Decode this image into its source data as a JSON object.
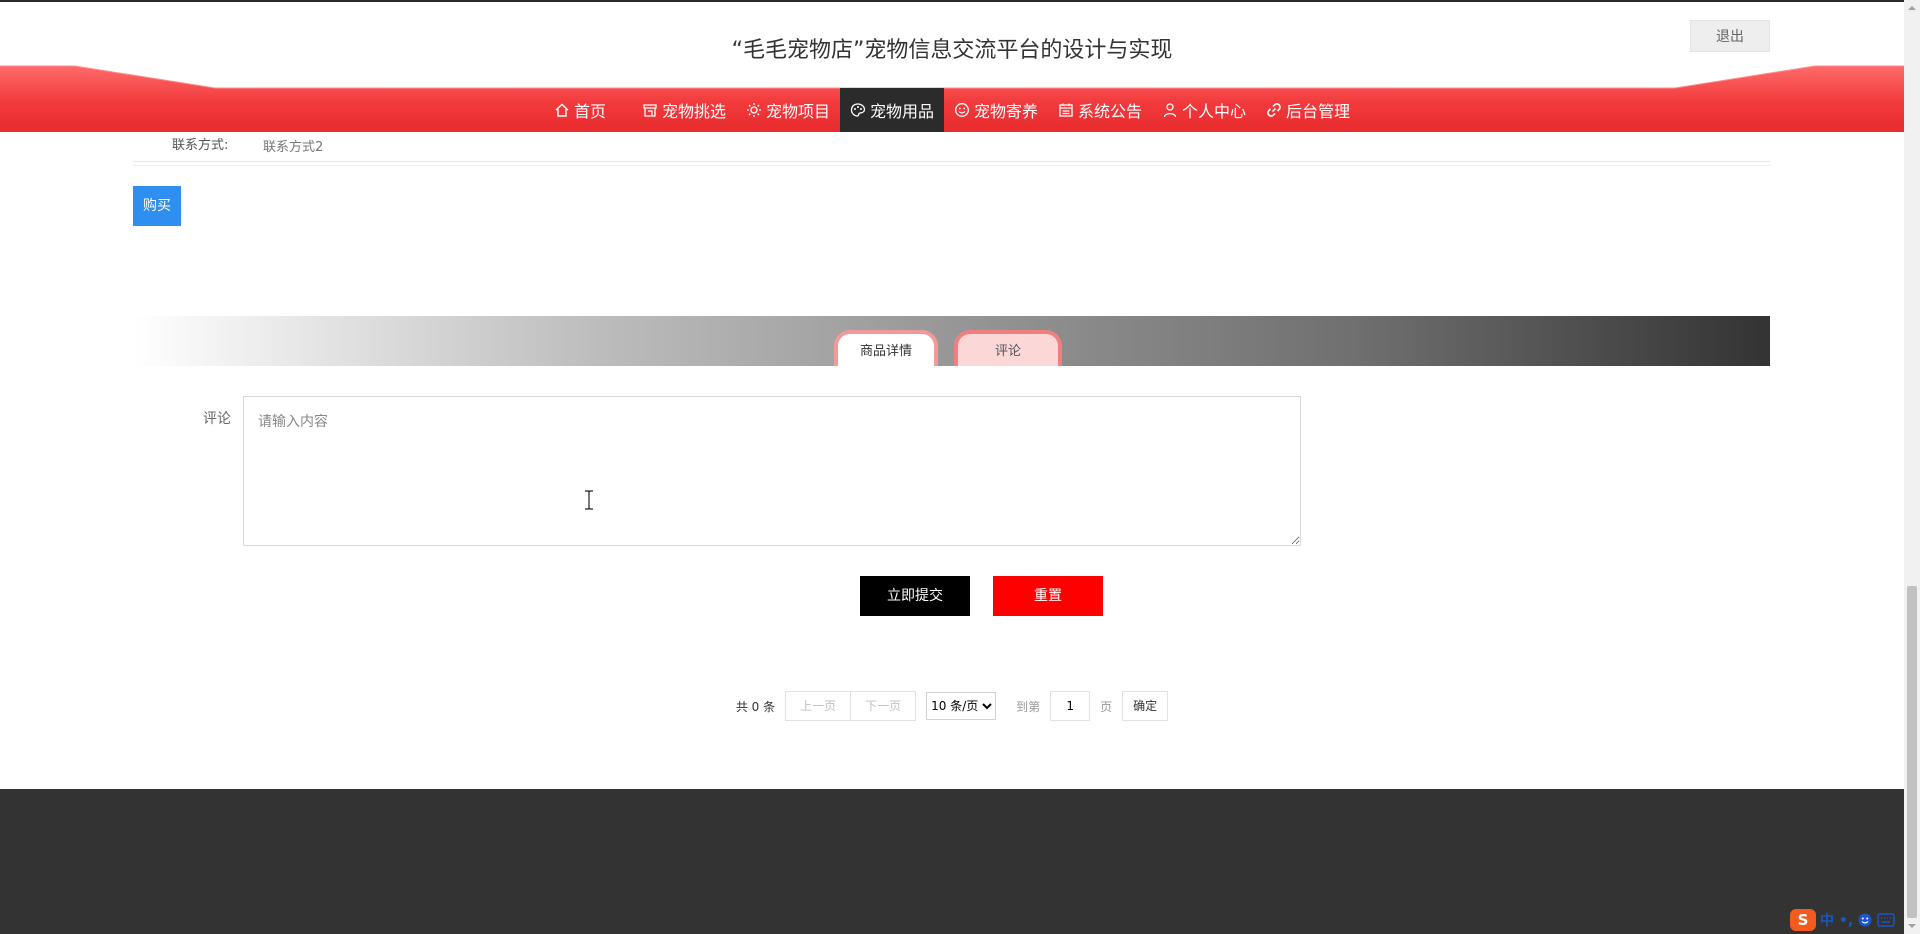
{
  "header": {
    "title": "“毛毛宠物店”宠物信息交流平台的设计与实现",
    "logout_label": "退出"
  },
  "nav": {
    "items": [
      {
        "label": "首页",
        "icon": "home-icon"
      },
      {
        "label": "宠物挑选",
        "icon": "shop-icon"
      },
      {
        "label": "宠物项目",
        "icon": "sun-icon"
      },
      {
        "label": "宠物用品",
        "icon": "palette-icon",
        "active": true
      },
      {
        "label": "宠物寄养",
        "icon": "smile-icon"
      },
      {
        "label": "系统公告",
        "icon": "calendar-icon"
      },
      {
        "label": "个人中心",
        "icon": "user-icon"
      },
      {
        "label": "后台管理",
        "icon": "link-icon"
      }
    ]
  },
  "detail": {
    "contact_label": "联系方式:",
    "contact_value": "联系方式2",
    "buy_label": "购买"
  },
  "tabs": {
    "detail_label": "商品详情",
    "comment_label": "评论"
  },
  "comment_form": {
    "label": "评论",
    "placeholder": "请输入内容",
    "value": "",
    "submit_label": "立即提交",
    "reset_label": "重置"
  },
  "pagination": {
    "total_text": "共 0 条",
    "prev_label": "上一页",
    "next_label": "下一页",
    "page_size_selected": "10 条/页",
    "goto_label": "到第",
    "page_value": "1",
    "page_suffix": "页",
    "confirm_label": "确定"
  },
  "ime": {
    "logo": "S",
    "text": "中 •,"
  },
  "colors": {
    "nav_red": "#f23a3c",
    "nav_active": "#2b2b2b",
    "buy_blue": "#2e8ff0",
    "reset_red": "#ff0000",
    "footer": "#333333"
  }
}
